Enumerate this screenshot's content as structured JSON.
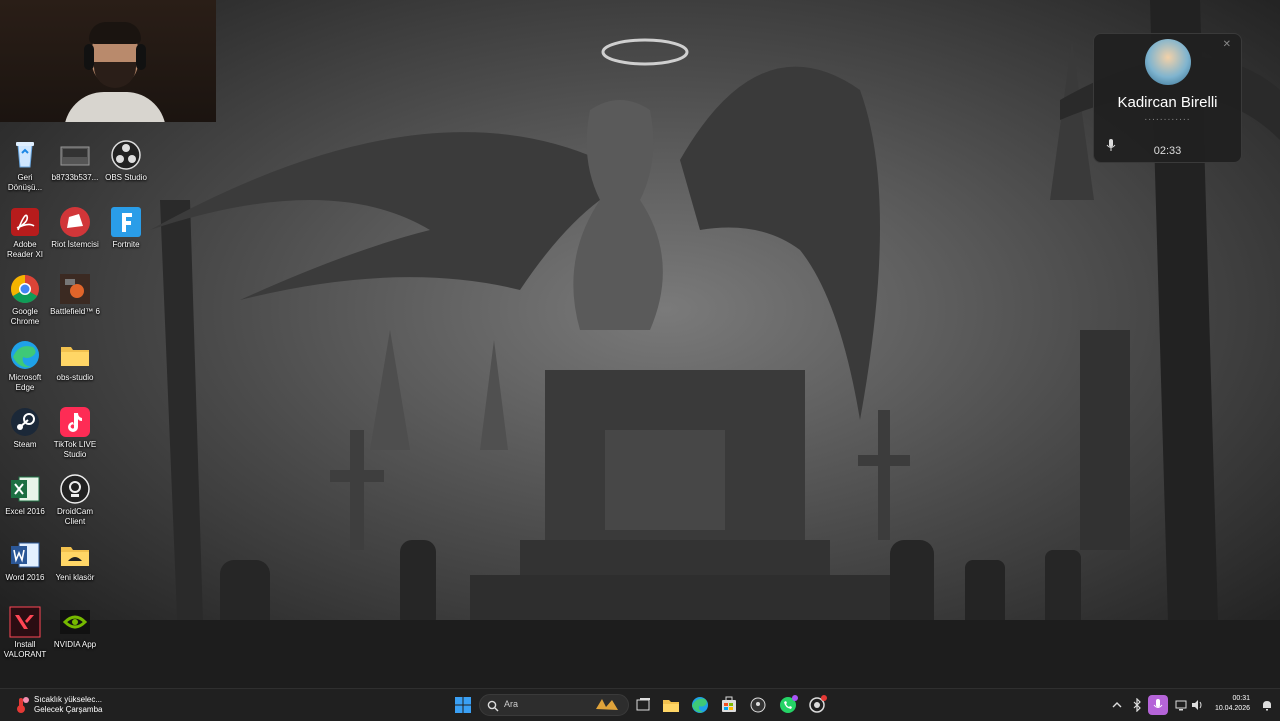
{
  "webcam": {},
  "desktop_icons": [
    {
      "label": "Geri Dönüşü...",
      "icon": "recycle-bin-icon"
    },
    {
      "label": "b8733b537...",
      "icon": "image-file-icon"
    },
    {
      "label": "OBS Studio",
      "icon": "obs-icon"
    },
    {
      "label": "Adobe Reader XI",
      "icon": "adobe-reader-icon"
    },
    {
      "label": "Riot İstemcisi",
      "icon": "riot-client-icon"
    },
    {
      "label": "Fortnite",
      "icon": "fortnite-icon"
    },
    {
      "label": "Google Chrome",
      "icon": "chrome-icon"
    },
    {
      "label": "Battlefield™ 6",
      "icon": "battlefield-icon"
    },
    {
      "label": "Microsoft Edge",
      "icon": "edge-icon"
    },
    {
      "label": "obs-studio",
      "icon": "folder-icon"
    },
    {
      "label": "Steam",
      "icon": "steam-icon"
    },
    {
      "label": "TikTok LIVE Studio",
      "icon": "tiktok-icon"
    },
    {
      "label": "Excel 2016",
      "icon": "excel-icon"
    },
    {
      "label": "DroidCam Client",
      "icon": "droidcam-icon"
    },
    {
      "label": "Word 2016",
      "icon": "word-icon"
    },
    {
      "label": "Yeni klasör",
      "icon": "folder-icon"
    },
    {
      "label": "Install VALORANT",
      "icon": "valorant-icon"
    },
    {
      "label": "NVIDIA App",
      "icon": "nvidia-icon"
    }
  ],
  "call": {
    "name": "Kadircan Birelli",
    "dots": "............",
    "duration": "02:33",
    "close": "✕"
  },
  "taskbar": {
    "weather_line1": "Sıcaklık yükselec...",
    "weather_line2": "Gelecek Çarşamba",
    "search_placeholder": "Ara",
    "time": "00:31",
    "date": "10.04.2026"
  },
  "colors": {
    "taskbar_bg": "#202020",
    "accent": "#0078d4"
  }
}
